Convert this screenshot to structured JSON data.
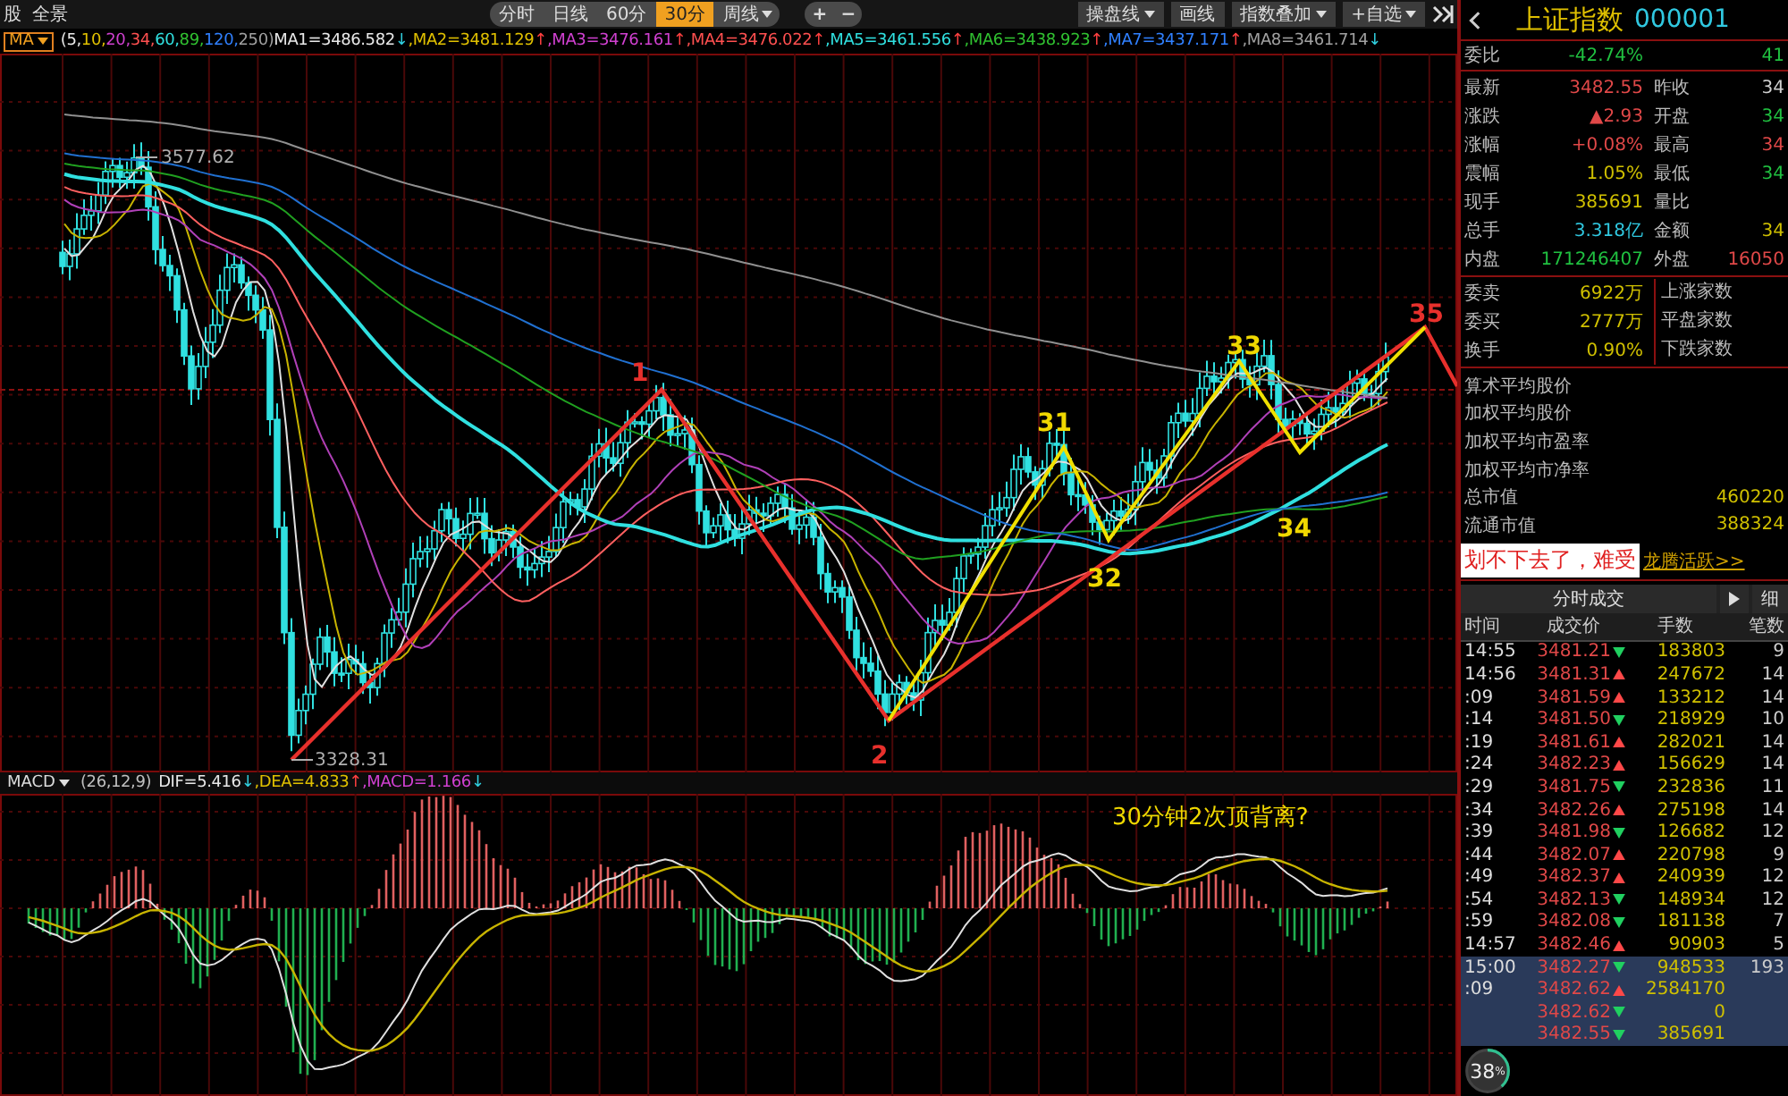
{
  "toolbar": {
    "left": [
      "股",
      "全景"
    ],
    "periods": [
      {
        "label": "分时",
        "selected": false
      },
      {
        "label": "日线",
        "selected": false
      },
      {
        "label": "60分",
        "selected": false
      },
      {
        "label": "30分",
        "selected": true
      },
      {
        "label": "周线",
        "selected": false
      }
    ],
    "zoom_buttons": [
      "+",
      "−"
    ],
    "tools": [
      {
        "label": "操盘线",
        "has_menu": true
      },
      {
        "label": "画线",
        "has_menu": false
      },
      {
        "label": "指数叠加",
        "has_menu": true
      },
      {
        "label": "+自选",
        "has_menu": true
      }
    ]
  },
  "ma_bar": {
    "button": "MA",
    "params": [
      {
        "text": "(5,",
        "color": "#e8e8e8"
      },
      {
        "text": "10,",
        "color": "#e0c000"
      },
      {
        "text": "20,",
        "color": "#d040d0"
      },
      {
        "text": "34,",
        "color": "#ff5050"
      },
      {
        "text": "60,",
        "color": "#30e0e0"
      },
      {
        "text": "89,",
        "color": "#30c030"
      },
      {
        "text": "120,",
        "color": "#3080ff"
      },
      {
        "text": "250)",
        "color": "#a0a0a0"
      }
    ],
    "lines": [
      {
        "text": "MA1=3486.582",
        "color": "#e8e8e8",
        "arrow": {
          "text": "↓",
          "color": "#30d0e0"
        }
      },
      {
        "text": ",MA2=3481.129",
        "color": "#e0c000",
        "arrow": {
          "text": "↑",
          "color": "#ff4040"
        }
      },
      {
        "text": ",MA3=3476.161",
        "color": "#d040d0",
        "arrow": {
          "text": "↑",
          "color": "#ff4040"
        }
      },
      {
        "text": ",MA4=3476.022",
        "color": "#ff5050",
        "arrow": {
          "text": "↑",
          "color": "#ff4040"
        }
      },
      {
        "text": ",MA5=3461.556",
        "color": "#30e0e0",
        "arrow": {
          "text": "↑",
          "color": "#ff4040"
        }
      },
      {
        "text": ",MA6=3438.923",
        "color": "#30c030",
        "arrow": {
          "text": "↑",
          "color": "#ff4040"
        }
      },
      {
        "text": ",MA7=3437.171",
        "color": "#3080ff",
        "arrow": {
          "text": "↑",
          "color": "#ff4040"
        }
      },
      {
        "text": ",MA8=3461.714",
        "color": "#a0a0a0",
        "arrow": {
          "text": "↓",
          "color": "#30d0e0"
        }
      }
    ]
  },
  "price_chart": {
    "annotations": [
      {
        "text": "3577.62",
        "kind": "price",
        "color": "#b0b0b0"
      },
      {
        "text": "3328.31",
        "kind": "price",
        "color": "#b0b0b0"
      },
      {
        "text": "1",
        "kind": "wave",
        "color": "#e8302c"
      },
      {
        "text": "2",
        "kind": "wave",
        "color": "#e8302c"
      },
      {
        "text": "31",
        "kind": "wave",
        "color": "#f0d800"
      },
      {
        "text": "32",
        "kind": "wave",
        "color": "#f0d800"
      },
      {
        "text": "33",
        "kind": "wave",
        "color": "#f0d800"
      },
      {
        "text": "34",
        "kind": "wave",
        "color": "#f0d800"
      },
      {
        "text": "35",
        "kind": "wave",
        "color": "#e8302c"
      }
    ]
  },
  "macd_bar": {
    "button": "MACD",
    "params": "(26,12,9)",
    "values": [
      {
        "text": "DIF=5.416",
        "color": "#e8e8e8",
        "arrow": {
          "text": "↓",
          "color": "#30d0e0"
        }
      },
      {
        "text": ",DEA=4.833",
        "color": "#e0c000",
        "arrow": {
          "text": "↑",
          "color": "#ff4040"
        }
      },
      {
        "text": ",MACD=1.166",
        "color": "#d040d0",
        "arrow": {
          "text": "↓",
          "color": "#30d0e0"
        }
      }
    ]
  },
  "macd_chart": {
    "note": "30分钟2次顶背离?"
  },
  "quote": {
    "title": "上证指数",
    "code": "000001",
    "ratio_row": {
      "label": "委比",
      "cells": [
        {
          "value": "-42.74%",
          "color": "#20c040"
        },
        {
          "value": "41",
          "color": "#20c040"
        }
      ]
    },
    "rows": [
      {
        "left": {
          "label": "最新",
          "value": "3482.55",
          "color": "#e04848"
        },
        "right": {
          "label": "昨收",
          "value": "34",
          "color": "#d0d0d0"
        }
      },
      {
        "left": {
          "label": "涨跌",
          "value": "▲2.93",
          "color": "#e04848"
        },
        "right": {
          "label": "开盘",
          "value": "34",
          "color": "#20c040"
        }
      },
      {
        "left": {
          "label": "涨幅",
          "value": "+0.08%",
          "color": "#e04848"
        },
        "right": {
          "label": "最高",
          "value": "34",
          "color": "#e04848"
        }
      },
      {
        "left": {
          "label": "震幅",
          "value": "1.05%",
          "color": "#d0c000"
        },
        "right": {
          "label": "最低",
          "value": "34",
          "color": "#20c040"
        }
      },
      {
        "left": {
          "label": "现手",
          "value": "385691",
          "color": "#d0c000"
        },
        "right": {
          "label": "量比"
        }
      },
      {
        "left": {
          "label": "总手",
          "value": "3.318亿",
          "color": "#30c8e0"
        },
        "right": {
          "label": "金额",
          "value": "34",
          "color": "#d0c000"
        }
      },
      {
        "left": {
          "label": "内盘",
          "value": "171246407",
          "color": "#20c040"
        },
        "right": {
          "label": "外盘",
          "value": "16050",
          "color": "#e04848"
        }
      }
    ],
    "order_rows": [
      {
        "label": "委卖",
        "value": "6922万",
        "right_label": "上涨家数"
      },
      {
        "label": "委买",
        "value": "2777万",
        "right_label": "平盘家数"
      },
      {
        "label": "换手",
        "value": "0.90%",
        "right_label": "下跌家数"
      }
    ],
    "stats": [
      {
        "label": "算术平均股价"
      },
      {
        "label": "加权平均股价"
      },
      {
        "label": "加权平均市盈率"
      },
      {
        "label": "加权平均市净率"
      },
      {
        "label": "总市值",
        "value": "460220"
      },
      {
        "label": "流通市值",
        "value": "388324"
      }
    ]
  },
  "note": {
    "text": "划不下去了，难受",
    "link": "龙腾活跃>>"
  },
  "trades": {
    "tab": "分时成交",
    "extra_tab": "细",
    "columns": [
      "时间",
      "成交价",
      "手数",
      "笔数"
    ],
    "rows": [
      {
        "time": "14:55",
        "price": "3481.21",
        "kind": "down",
        "volume": "183803",
        "count": "9",
        "selected": false
      },
      {
        "time": "14:56",
        "price": "3481.31",
        "kind": "up",
        "volume": "247672",
        "count": "14",
        "selected": false
      },
      {
        "time": ":09",
        "price": "3481.59",
        "kind": "up",
        "volume": "133212",
        "count": "14",
        "selected": false
      },
      {
        "time": ":14",
        "price": "3481.50",
        "kind": "down",
        "volume": "218929",
        "count": "10",
        "selected": false
      },
      {
        "time": ":19",
        "price": "3481.61",
        "kind": "up",
        "volume": "282021",
        "count": "14",
        "selected": false
      },
      {
        "time": ":24",
        "price": "3482.23",
        "kind": "up",
        "volume": "156629",
        "count": "14",
        "selected": false
      },
      {
        "time": ":29",
        "price": "3481.75",
        "kind": "down",
        "volume": "232836",
        "count": "11",
        "selected": false
      },
      {
        "time": ":34",
        "price": "3482.26",
        "kind": "up",
        "volume": "275198",
        "count": "14",
        "selected": false
      },
      {
        "time": ":39",
        "price": "3481.98",
        "kind": "down",
        "volume": "126682",
        "count": "12",
        "selected": false
      },
      {
        "time": ":44",
        "price": "3482.07",
        "kind": "up",
        "volume": "220798",
        "count": "9",
        "selected": false
      },
      {
        "time": ":49",
        "price": "3482.37",
        "kind": "up",
        "volume": "240939",
        "count": "12",
        "selected": false
      },
      {
        "time": ":54",
        "price": "3482.13",
        "kind": "down",
        "volume": "148934",
        "count": "12",
        "selected": false
      },
      {
        "time": ":59",
        "price": "3482.08",
        "kind": "down",
        "volume": "181138",
        "count": "7",
        "selected": false
      },
      {
        "time": "14:57",
        "price": "3482.46",
        "kind": "up",
        "volume": "90903",
        "count": "5",
        "selected": false
      },
      {
        "time": "15:00",
        "price": "3482.27",
        "kind": "down",
        "volume": "948533",
        "count": "193",
        "selected": true
      },
      {
        "time": ":09",
        "price": "3482.62",
        "kind": "up",
        "volume": "2584170",
        "selected": true
      },
      {
        "price": "3482.62",
        "kind": "down",
        "volume": "0",
        "selected": true
      },
      {
        "price": "3482.55",
        "kind": "down",
        "volume": "385691",
        "selected": true
      }
    ]
  },
  "progress_badge": {
    "text": "38",
    "unit": "%",
    "level": 0.38
  }
}
